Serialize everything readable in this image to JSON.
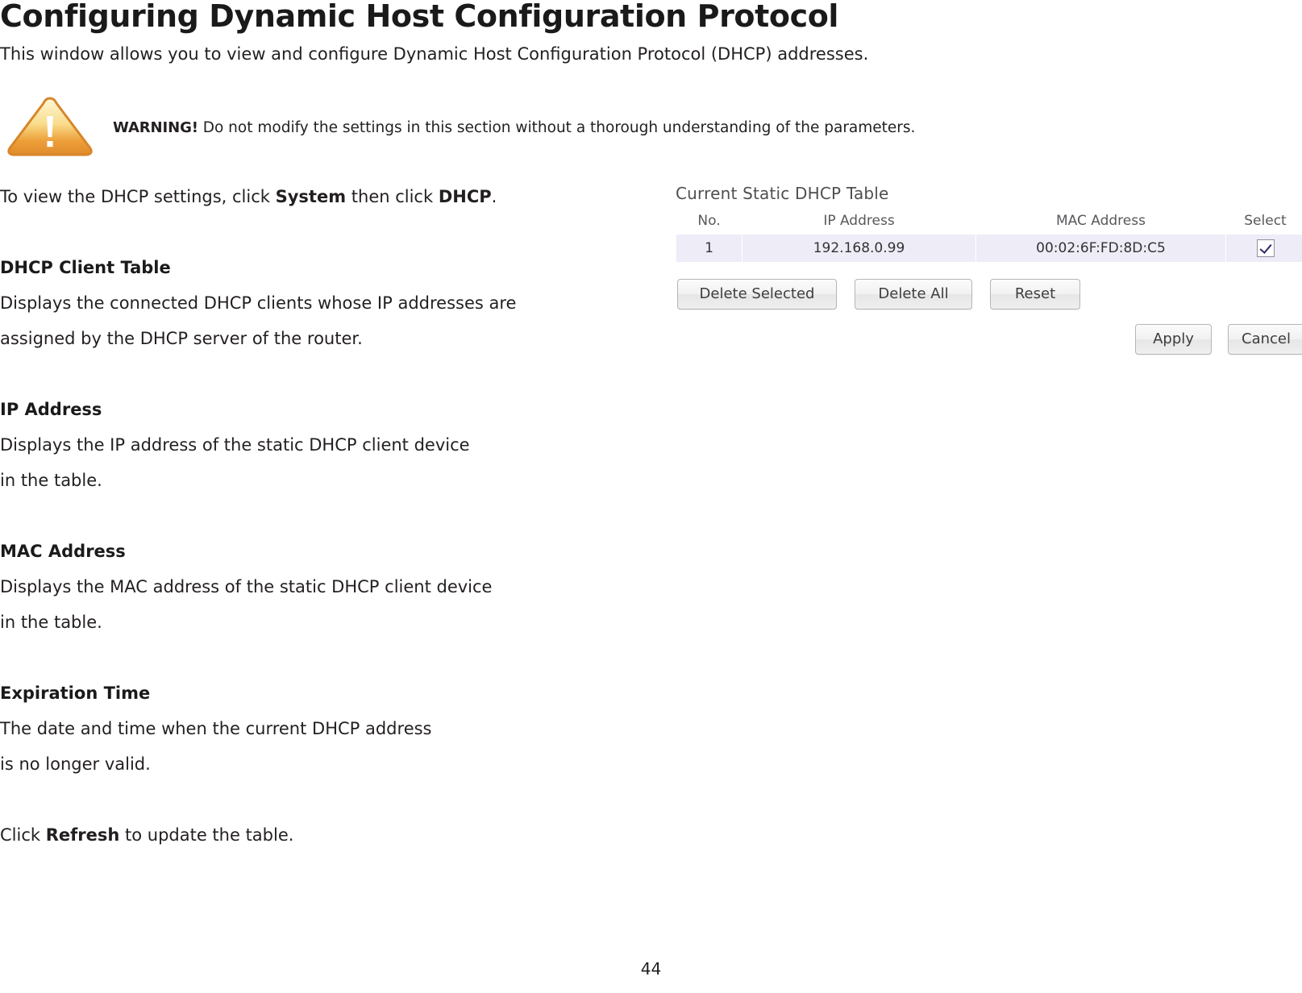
{
  "document": {
    "title": "Configuring Dynamic Host Configuration Protocol",
    "intro": "This window allows you to view and configure Dynamic Host Configuration Protocol (DHCP) addresses.",
    "page_number": "44"
  },
  "warning": {
    "icon": "warning-triangle-icon",
    "label": "WARNING!",
    "text": " Do not modify the settings in this section without a thorough understanding of the parameters."
  },
  "body": {
    "view_instruction": {
      "pre": "To view the DHCP settings, click ",
      "bold1": "System",
      "mid": " then click ",
      "bold2": "DHCP",
      "post": "."
    },
    "sections": [
      {
        "heading": "DHCP Client Table",
        "lines": [
          "Displays the connected DHCP clients whose IP addresses are",
          "assigned by the DHCP server of the router."
        ]
      },
      {
        "heading": "IP Address",
        "lines": [
          "Displays the IP address of the static DHCP client device",
          "in the table."
        ]
      },
      {
        "heading": "MAC Address",
        "lines": [
          "Displays the MAC address of the static DHCP client device",
          "in the table."
        ]
      },
      {
        "heading": "Expiration Time",
        "lines": [
          "The date and time when the current DHCP address",
          "is no longer valid."
        ]
      }
    ],
    "refresh_instruction": {
      "pre": "Click ",
      "bold": "Refresh",
      "post": " to update the table."
    }
  },
  "ui_screenshot": {
    "caption": "Current Static DHCP Table",
    "table": {
      "columns": [
        "No.",
        "IP Address",
        "MAC Address",
        "Select"
      ],
      "rows": [
        {
          "no": "1",
          "ip": "192.168.0.99",
          "mac": "00:02:6F:FD:8D:C5",
          "selected": true
        }
      ]
    },
    "buttons": {
      "delete_selected": "Delete Selected",
      "delete_all": "Delete All",
      "reset": "Reset",
      "apply": "Apply",
      "cancel": "Cancel"
    }
  }
}
